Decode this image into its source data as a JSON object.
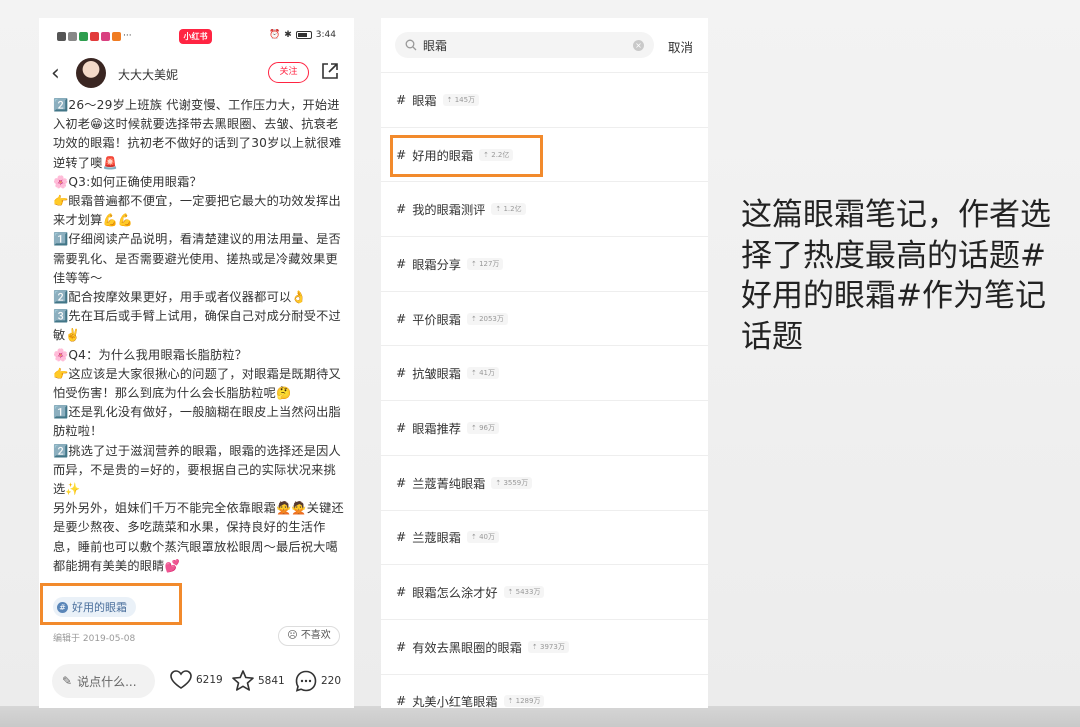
{
  "left_phone": {
    "status": {
      "app_logo": "小红书",
      "time": "3:44",
      "left_icons": [
        "signal-icon",
        "wifi-icon",
        "app-icon",
        "app-icon",
        "app-icon",
        "app-icon"
      ],
      "dots": "···"
    },
    "nav": {
      "author": "大大大美妮",
      "follow_label": "关注"
    },
    "note_text": "2️⃣26～29岁上班族 代谢变慢、工作压力大，开始进入初老😁这时候就要选择带去黑眼圈、去皱、抗衰老功效的眼霜！抗初老不做好的话到了30岁以上就很难逆转了噢🚨\n🌸Q3:如何正确使用眼霜？\n👉眼霜普遍都不便宜，一定要把它最大的功效发挥出来才划算💪💪\n1️⃣仔细阅读产品说明，看清楚建议的用法用量、是否需要乳化、是否需要避光使用、搓热或是冷藏效果更佳等等～\n2️⃣配合按摩效果更好，用手或者仪器都可以👌\n3️⃣先在耳后或手臂上试用，确保自己对成分耐受不过敏✌️\n🌸Q4：为什么我用眼霜长脂肪粒？\n👉这应该是大家很揪心的问题了，对眼霜是既期待又怕受伤害！那么到底为什么会长脂肪粒呢🤔\n1️⃣还是乳化没有做好，一般脑糊在眼皮上当然闷出脂肪粒啦！\n2️⃣挑选了过于滋润营养的眼霜，眼霜的选择还是因人而异，不是贵的=好的，要根据自己的实际状况来挑选✨\n另外另外，姐妹们千万不能完全依靠眼霜🙅🙅关键还是要少熬夜、多吃蔬菜和水果，保持良好的生活作息，睡前也可以敷个蒸汽眼罩放松眼周～最后祝大噶都能拥有美美的眼睛💕",
    "tag": "好用的眼霜",
    "edit_date": "编辑于 2019-05-08",
    "dislike_label": "不喜欢",
    "comment_placeholder": "说点什么...",
    "likes": "6219",
    "collects": "5841",
    "comments": "220"
  },
  "right_phone": {
    "search_value": "眼霜",
    "cancel_label": "取消",
    "topics": [
      {
        "name": "眼霜",
        "count": "145万"
      },
      {
        "name": "好用的眼霜",
        "count": "2.2亿"
      },
      {
        "name": "我的眼霜测评",
        "count": "1.2亿"
      },
      {
        "name": "眼霜分享",
        "count": "127万"
      },
      {
        "name": "平价眼霜",
        "count": "2053万"
      },
      {
        "name": "抗皱眼霜",
        "count": "41万"
      },
      {
        "name": "眼霜推荐",
        "count": "96万"
      },
      {
        "name": "兰蔻菁纯眼霜",
        "count": "3559万"
      },
      {
        "name": "兰蔻眼霜",
        "count": "40万"
      },
      {
        "name": "眼霜怎么涂才好",
        "count": "5433万"
      },
      {
        "name": "有效去黑眼圈的眼霜",
        "count": "3973万"
      },
      {
        "name": "丸美小红笔眼霜",
        "count": "1289万"
      }
    ]
  },
  "caption": "这篇眼霜笔记，作者选择了热度最高的话题#好用的眼霜#作为笔记话题",
  "colors": {
    "brand": "#ff2442",
    "highlight": "#f28a2c",
    "tag_text": "#4a6f9c"
  }
}
